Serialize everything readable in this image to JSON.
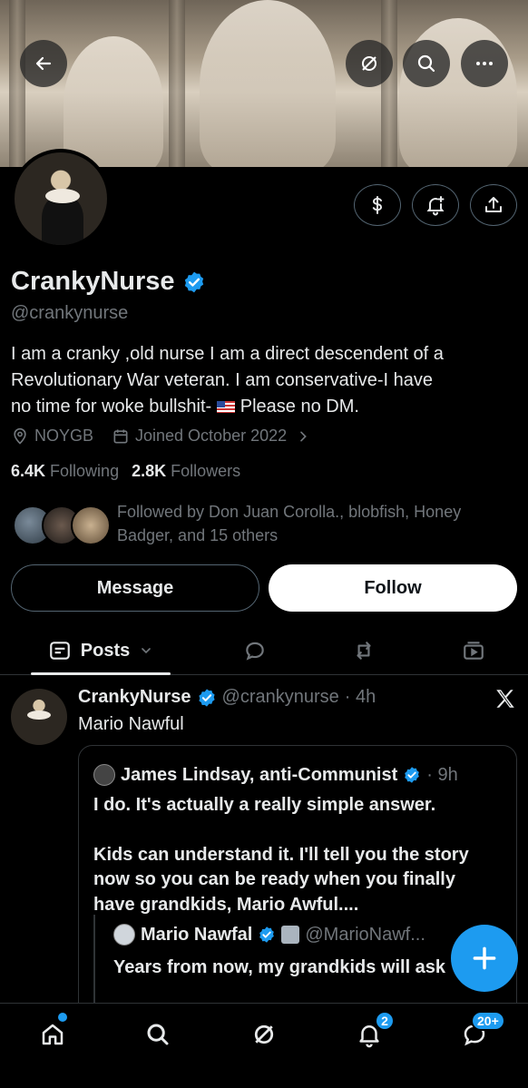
{
  "profile": {
    "name": "CrankyNurse",
    "handle": "@crankynurse",
    "bio_line1": "I am a cranky ,old nurse I am a direct descendent of a",
    "bio_line2": "Revolutionary War veteran. I am conservative-I have",
    "bio_line3": "no time for woke bullshit- ",
    "bio_line3_end": "Please no DM.",
    "location": "NOYGB",
    "joined": "Joined October 2022",
    "following_count": "6.4K",
    "following_label": "Following",
    "followers_count": "2.8K",
    "followers_label": "Followers",
    "followed_by": "Followed by Don Juan Corolla., blobfish, Honey Badger, and 15 others"
  },
  "buttons": {
    "message": "Message",
    "follow": "Follow"
  },
  "tabs": {
    "posts": "Posts"
  },
  "post": {
    "author": "CrankyNurse",
    "handle": "@crankynurse",
    "time": "· 4h",
    "text": "Mario Nawful",
    "quote": {
      "author": "James Lindsay, anti-Communist",
      "time": "· 9h",
      "line1": "I do. It's actually a really simple answer.",
      "line2": "Kids can understand it. I'll tell you the story now so you can be ready when you finally have grandkids, Mario Awful....",
      "nested": {
        "author": "Mario Nawfal",
        "handle": "@MarioNawf...",
        "text": "Years from now, my grandkids will ask"
      }
    }
  },
  "nav": {
    "notifications_badge": "2",
    "messages_badge": "20+"
  },
  "colors": {
    "accent": "#1d9bf0",
    "background": "#000000",
    "text": "#e7e9ea",
    "muted": "#71767b"
  }
}
